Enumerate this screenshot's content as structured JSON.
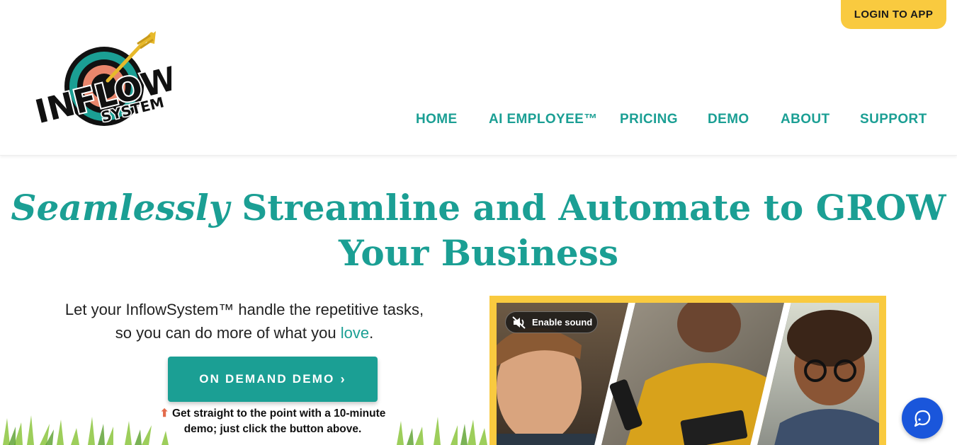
{
  "header": {
    "login_label": "LOGIN TO APP",
    "logo": {
      "word1": "INFLOW",
      "word2": "SYSTEM",
      "icon": "target-arrow-logo"
    },
    "nav": [
      {
        "label": "HOME"
      },
      {
        "label": "AI EMPLOYEE™"
      },
      {
        "label": "PRICING"
      },
      {
        "label": "DEMO"
      },
      {
        "label": "ABOUT"
      },
      {
        "label": "SUPPORT"
      }
    ]
  },
  "hero": {
    "title_emphasis": "Seamlessly",
    "title_mid": "Streamline and Automate to",
    "title_strong": "GROW",
    "title_line2": "Your Business",
    "tagline_line1": "Let your InflowSystem™ handle the repetitive tasks,",
    "tagline_line2_pre": "so you can do more of what you",
    "tagline_love": "love",
    "tagline_end": ".",
    "demo_button": "ON DEMAND DEMO",
    "demo_chevron": "›",
    "hint_arrow": "⬆",
    "hint_text": "Get straight to the point with a 10-minute demo; just click the button above."
  },
  "video": {
    "sound_label": "Enable sound",
    "sound_icon": "muted-speaker-icon"
  },
  "chat": {
    "icon": "chat-bubble-icon"
  },
  "colors": {
    "brand_teal": "#1b9f94",
    "accent_yellow": "#f9ca3f",
    "chat_blue": "#1a56db",
    "text_dark": "#222222"
  }
}
